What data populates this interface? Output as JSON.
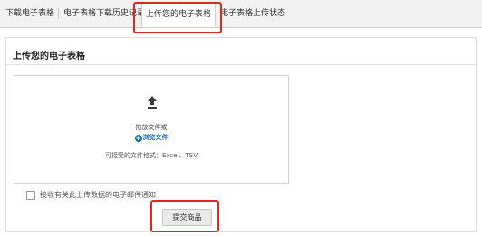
{
  "tabs": [
    {
      "label": "下载电子表格"
    },
    {
      "label": "电子表格下载历史记录"
    },
    {
      "label": "上传您的电子表格"
    },
    {
      "label": "电子表格上传状态"
    }
  ],
  "section": {
    "title": "上传您的电子表格"
  },
  "dropzone": {
    "drag_text": "拖放文件或",
    "browse_label": "浏览文件",
    "browse_icon": "plus-circle-icon",
    "upload_icon": "upload-arrow-icon",
    "formats_text": "可接受的文件格式：Excel、TSV"
  },
  "notify": {
    "label": "接收有关此上传数据的电子邮件通知",
    "checked": false
  },
  "submit": {
    "label": "提交商品"
  },
  "colors": {
    "highlight": "#e0281c",
    "link": "#1f6fb5",
    "tab_bar": "#f2f2f2"
  }
}
